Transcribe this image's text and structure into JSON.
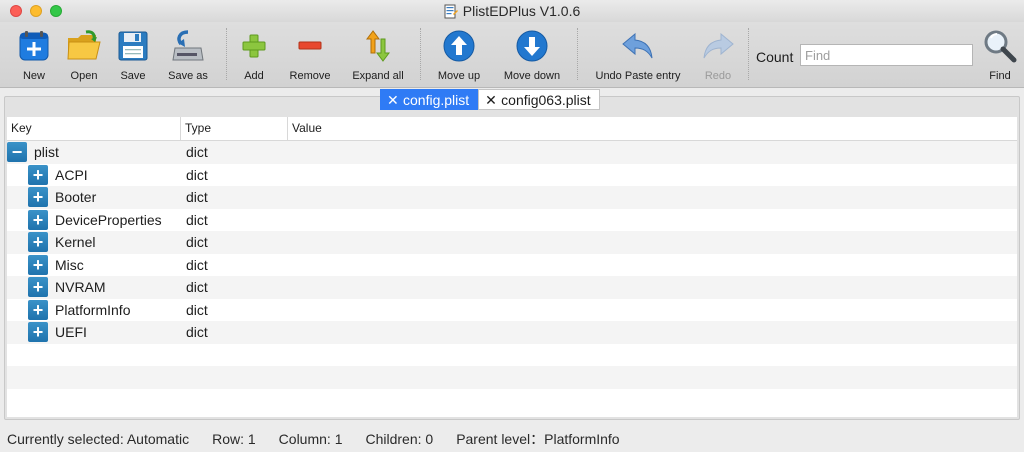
{
  "window": {
    "title": "PlistEDPlus V1.0.6",
    "icon": "plist-document-icon"
  },
  "toolbar": {
    "new": "New",
    "open": "Open",
    "save": "Save",
    "save_as": "Save as",
    "add": "Add",
    "remove": "Remove",
    "expand_all": "Expand all",
    "move_up": "Move up",
    "move_down": "Move down",
    "undo": "Undo Paste entry",
    "redo": "Redo",
    "count_label": "Count",
    "find_placeholder": "Find",
    "find_value": "",
    "find": "Find"
  },
  "tabs": [
    {
      "label": "config.plist",
      "active": true
    },
    {
      "label": "config063.plist",
      "active": false
    }
  ],
  "table": {
    "columns": [
      "Key",
      "Type",
      "Value"
    ],
    "rows": [
      {
        "key": "plist",
        "type": "dict",
        "value": "",
        "level": 0,
        "expanded": true,
        "toggle": "−"
      },
      {
        "key": "ACPI",
        "type": "dict",
        "value": "",
        "level": 1,
        "expanded": false,
        "toggle": "+"
      },
      {
        "key": "Booter",
        "type": "dict",
        "value": "",
        "level": 1,
        "expanded": false,
        "toggle": "+"
      },
      {
        "key": "DeviceProperties",
        "type": "dict",
        "value": "",
        "level": 1,
        "expanded": false,
        "toggle": "+"
      },
      {
        "key": "Kernel",
        "type": "dict",
        "value": "",
        "level": 1,
        "expanded": false,
        "toggle": "+"
      },
      {
        "key": "Misc",
        "type": "dict",
        "value": "",
        "level": 1,
        "expanded": false,
        "toggle": "+"
      },
      {
        "key": "NVRAM",
        "type": "dict",
        "value": "",
        "level": 1,
        "expanded": false,
        "toggle": "+"
      },
      {
        "key": "PlatformInfo",
        "type": "dict",
        "value": "",
        "level": 1,
        "expanded": false,
        "toggle": "+"
      },
      {
        "key": "UEFI",
        "type": "dict",
        "value": "",
        "level": 1,
        "expanded": false,
        "toggle": "+"
      }
    ],
    "empty_rows": 3
  },
  "status": {
    "selected": "Currently selected: Automatic",
    "row": "Row: 1",
    "column": "Column: 1",
    "children": "Children: 0",
    "parent": "Parent level：PlatformInfo"
  },
  "colors": {
    "accent": "#2f7bf5",
    "toggle": "#2a83bd",
    "toolbar_blue": "#2c7cc0"
  }
}
